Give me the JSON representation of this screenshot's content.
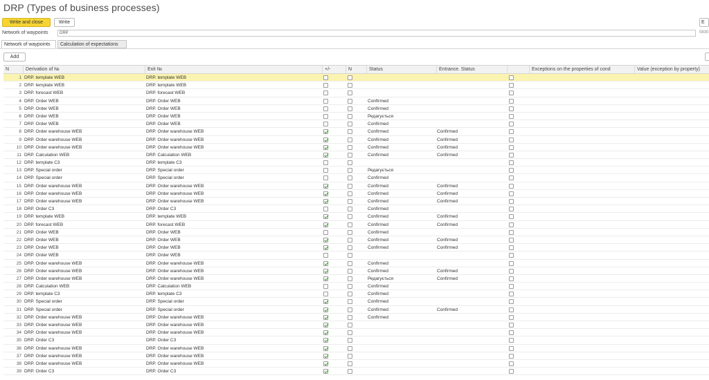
{
  "window": {
    "title": "DRP (Types of business processes)"
  },
  "toolbar": {
    "write_close_label": "Write and close",
    "write_label": "Write",
    "more_label": "E"
  },
  "field": {
    "label": "Network of waypoints",
    "value": "DRP",
    "extra": "0830"
  },
  "tabs": [
    "Network of waypoints",
    "Calculation of expectations"
  ],
  "table_toolbar": {
    "add_label": "Add"
  },
  "columns": {
    "num": "N",
    "derivation": "Derivation of №",
    "exit": "Exit №",
    "c1": "+/-",
    "c2": "N",
    "status": "Status",
    "entrance_status": "Entrance. Status",
    "c3": "",
    "exceptions": "Exceptions on the properties of cond",
    "value": "Value (exception by property)"
  },
  "rows": [
    {
      "n": "1",
      "d": "DRP. template WEB",
      "e": "DRP. template WEB",
      "c": false,
      "s": "",
      "es": ""
    },
    {
      "n": "2",
      "d": "DRP. template WEB",
      "e": "DRP. template WEB",
      "c": false,
      "s": "",
      "es": ""
    },
    {
      "n": "3",
      "d": "DRP. forecast WEB",
      "e": "DRP. forecast WEB",
      "c": false,
      "s": "",
      "es": ""
    },
    {
      "n": "4",
      "d": "DRP. Order WEB",
      "e": "DRP. Order WEB",
      "c": false,
      "s": "Confirmed",
      "es": ""
    },
    {
      "n": "5",
      "d": "DRP. Order WEB",
      "e": "DRP. Order WEB",
      "c": false,
      "s": "Confirmed",
      "es": ""
    },
    {
      "n": "6",
      "d": "DRP. Order WEB",
      "e": "DRP. Order WEB",
      "c": false,
      "s": "Редагується",
      "es": ""
    },
    {
      "n": "7",
      "d": "DRP. Order WEB",
      "e": "DRP. Order WEB",
      "c": false,
      "s": "Confirmed",
      "es": ""
    },
    {
      "n": "8",
      "d": "DRP. Order warehouse WEB",
      "e": "DRP. Order warehouse WEB",
      "c": true,
      "s": "Confirmed",
      "es": "Confirmed"
    },
    {
      "n": "9",
      "d": "DRP. Order warehouse WEB",
      "e": "DRP. Order warehouse WEB",
      "c": true,
      "s": "Confirmed",
      "es": "Confirmed"
    },
    {
      "n": "10",
      "d": "DRP. Order warehouse WEB",
      "e": "DRP. Order warehouse WEB",
      "c": true,
      "s": "Confirmed",
      "es": "Confirmed"
    },
    {
      "n": "11",
      "d": "DRP. Calculation WEB",
      "e": "DRP. Calculation WEB",
      "c": true,
      "s": "Confirmed",
      "es": "Confirmed"
    },
    {
      "n": "12",
      "d": "DRP. template C3",
      "e": "DRP. template C3",
      "c": false,
      "s": "",
      "es": ""
    },
    {
      "n": "13",
      "d": "DRP. Special order",
      "e": "DRP. Special order",
      "c": false,
      "s": "Редагується",
      "es": ""
    },
    {
      "n": "14",
      "d": "DRP. Special order",
      "e": "DRP. Special order",
      "c": false,
      "s": "Confirmed",
      "es": ""
    },
    {
      "n": "15",
      "d": "DRP. Order warehouse WEB",
      "e": "DRP. Order warehouse WEB",
      "c": true,
      "s": "Confirmed",
      "es": "Confirmed"
    },
    {
      "n": "16",
      "d": "DRP. Order warehouse WEB",
      "e": "DRP. Order warehouse WEB",
      "c": true,
      "s": "Confirmed",
      "es": "Confirmed"
    },
    {
      "n": "17",
      "d": "DRP. Order warehouse WEB",
      "e": "DRP. Order warehouse WEB",
      "c": true,
      "s": "Confirmed",
      "es": "Confirmed"
    },
    {
      "n": "18",
      "d": "DRP. Order C3",
      "e": "DRP. Order C3",
      "c": false,
      "s": "Confirmed",
      "es": ""
    },
    {
      "n": "19",
      "d": "DRP. template WEB",
      "e": "DRP. template WEB",
      "c": true,
      "s": "Confirmed",
      "es": "Confirmed"
    },
    {
      "n": "20",
      "d": "DRP. forecast WEB",
      "e": "DRP. forecast WEB",
      "c": true,
      "s": "Confirmed",
      "es": "Confirmed"
    },
    {
      "n": "21",
      "d": "DRP. Order WEB",
      "e": "DRP. Order WEB",
      "c": false,
      "s": "Confirmed",
      "es": ""
    },
    {
      "n": "22",
      "d": "DRP. Order WEB",
      "e": "DRP. Order WEB",
      "c": true,
      "s": "Confirmed",
      "es": "Confirmed"
    },
    {
      "n": "23",
      "d": "DRP. Order WEB",
      "e": "DRP. Order WEB",
      "c": true,
      "s": "Confirmed",
      "es": "Confirmed"
    },
    {
      "n": "24",
      "d": "DRP. Order WEB",
      "e": "DRP. Order WEB",
      "c": false,
      "s": "",
      "es": ""
    },
    {
      "n": "25",
      "d": "DRP. Order warehouse WEB",
      "e": "DRP. Order warehouse WEB",
      "c": true,
      "s": "Confirmed",
      "es": ""
    },
    {
      "n": "26",
      "d": "DRP. Order warehouse WEB",
      "e": "DRP. Order warehouse WEB",
      "c": true,
      "s": "Confirmed",
      "es": "Confirmed"
    },
    {
      "n": "27",
      "d": "DRP. Order warehouse WEB",
      "e": "DRP. Order warehouse WEB",
      "c": true,
      "s": "Редагується",
      "es": "Confirmed"
    },
    {
      "n": "28",
      "d": "DRP. Calculation WEB",
      "e": "DRP. Calculation WEB",
      "c": false,
      "s": "Confirmed",
      "es": ""
    },
    {
      "n": "29",
      "d": "DRP. template C3",
      "e": "DRP. template C3",
      "c": false,
      "s": "Confirmed",
      "es": ""
    },
    {
      "n": "30",
      "d": "DRP. Special order",
      "e": "DRP. Special order",
      "c": true,
      "s": "Confirmed",
      "es": ""
    },
    {
      "n": "31",
      "d": "DRP. Special order",
      "e": "DRP. Special order",
      "c": true,
      "s": "Confirmed",
      "es": "Confirmed"
    },
    {
      "n": "32",
      "d": "DRP. Order warehouse WEB",
      "e": "DRP. Order warehouse WEB",
      "c": true,
      "s": "Confirmed",
      "es": ""
    },
    {
      "n": "33",
      "d": "DRP. Order warehouse WEB",
      "e": "DRP. Order warehouse WEB",
      "c": true,
      "s": "",
      "es": ""
    },
    {
      "n": "34",
      "d": "DRP. Order warehouse WEB",
      "e": "DRP. Order warehouse WEB",
      "c": true,
      "s": "",
      "es": ""
    },
    {
      "n": "35",
      "d": "DRP. Order C3",
      "e": "DRP. Order C3",
      "c": true,
      "s": "",
      "es": ""
    },
    {
      "n": "36",
      "d": "DRP. Order warehouse WEB",
      "e": "DRP. Order warehouse WEB",
      "c": true,
      "s": "",
      "es": ""
    },
    {
      "n": "37",
      "d": "DRP. Order warehouse WEB",
      "e": "DRP. Order warehouse WEB",
      "c": true,
      "s": "",
      "es": ""
    },
    {
      "n": "38",
      "d": "DRP. Order warehouse WEB",
      "e": "DRP. Order warehouse WEB",
      "c": true,
      "s": "",
      "es": ""
    },
    {
      "n": "39",
      "d": "DRP. Order C3",
      "e": "DRP. Order C3",
      "c": true,
      "s": "",
      "es": ""
    }
  ]
}
